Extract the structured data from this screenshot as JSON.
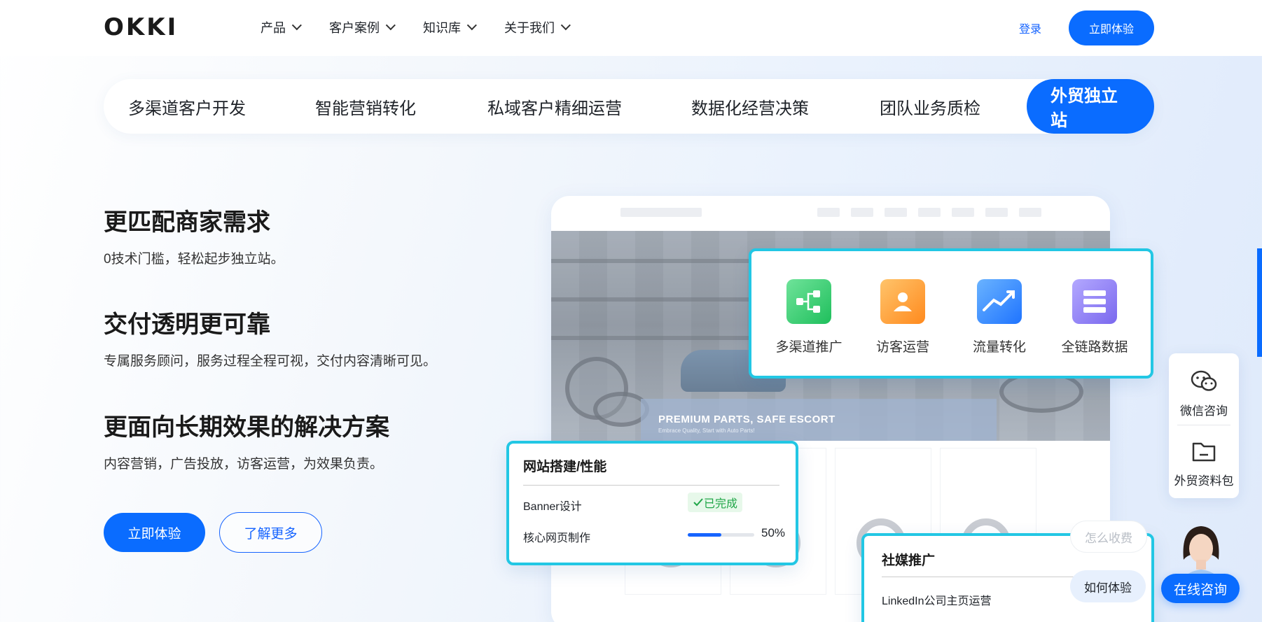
{
  "header": {
    "logo": "OKKI",
    "nav": [
      "产品",
      "客户案例",
      "知识库",
      "关于我们"
    ],
    "login": "登录",
    "cta": "立即体验"
  },
  "tabs": [
    "多渠道客户开发",
    "智能营销转化",
    "私域客户精细运营",
    "数据化经营决策",
    "团队业务质检",
    "外贸独立站"
  ],
  "active_tab": "外贸独立站",
  "features": [
    {
      "title": "更匹配商家需求",
      "desc": "0技术门槛，轻松起步独立站。"
    },
    {
      "title": "交付透明更可靠",
      "desc": "专属服务顾问，服务过程全程可视，交付内容清晰可见。"
    },
    {
      "title": "更面向长期效果的解决方案",
      "desc": "内容营销，广告投放，访客运营，为效果负责。"
    }
  ],
  "buttons": {
    "primary": "立即体验",
    "secondary": "了解更多"
  },
  "mockup": {
    "banner_title": "PREMIUM PARTS, SAFE ESCORT",
    "banner_sub": "Embrace Quality, Start with Auto Parts!"
  },
  "card_icons": [
    {
      "label": "多渠道推广",
      "icon": "channel-icon",
      "color": "#2ec86a"
    },
    {
      "label": "访客运营",
      "icon": "visitor-icon",
      "color": "#ff9c2a"
    },
    {
      "label": "流量转化",
      "icon": "trend-icon",
      "color": "#2f8bff"
    },
    {
      "label": "全链路数据",
      "icon": "data-stack-icon",
      "color": "#8a7cf2"
    }
  ],
  "card_web": {
    "title": "网站搭建/性能",
    "rows": [
      {
        "label": "Banner设计",
        "status": "已完成"
      },
      {
        "label": "核心网页制作",
        "progress": 0.5,
        "progress_text": "50%"
      }
    ]
  },
  "card_social": {
    "title": "社媒推广",
    "row": "LinkedIn公司主页运营"
  },
  "float_panel": [
    {
      "label": "微信咨询",
      "icon": "wechat-icon"
    },
    {
      "label": "外贸资料包",
      "icon": "folder-icon"
    }
  ],
  "chat": {
    "bubbles": [
      "怎么收费",
      "如何体验"
    ],
    "online_btn": "在线咨询"
  },
  "colors": {
    "primary": "#0a6cff",
    "card_border": "#22c7e4",
    "done_green": "#20a648"
  }
}
